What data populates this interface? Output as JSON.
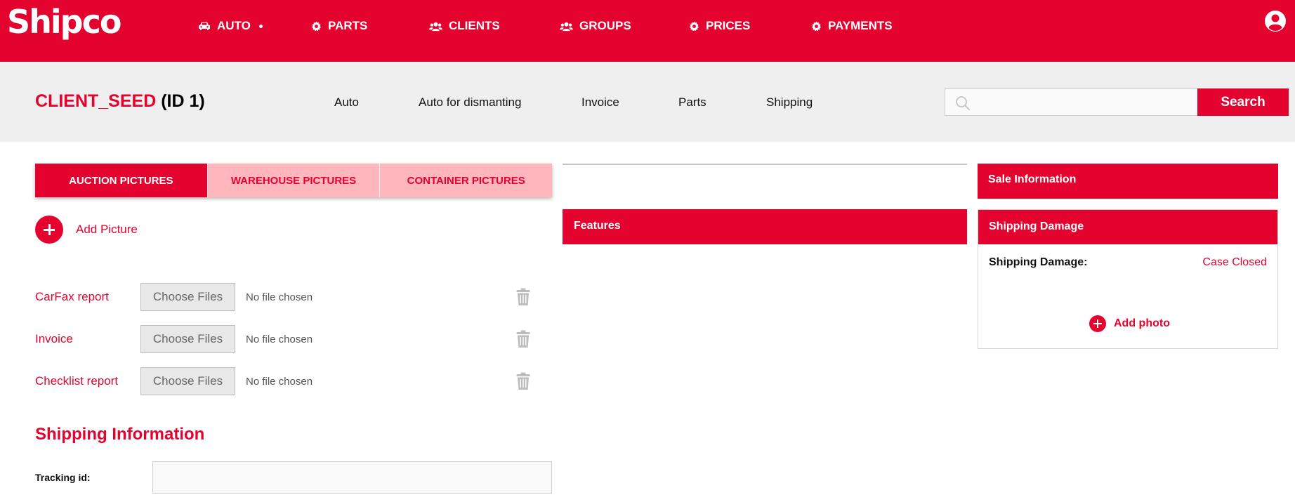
{
  "brand": {
    "name": "Shipco",
    "color": "#e4032e"
  },
  "nav": {
    "items": [
      {
        "label": "AUTO",
        "icon": "car-icon",
        "has_dot": true
      },
      {
        "label": "PARTS",
        "icon": "gear-icon"
      },
      {
        "label": "CLIENTS",
        "icon": "users-icon"
      },
      {
        "label": "GROUPS",
        "icon": "users-icon"
      },
      {
        "label": "PRICES",
        "icon": "gear-icon"
      },
      {
        "label": "PAYMENTS",
        "icon": "gear-icon"
      }
    ],
    "user_icon": "user-circle-icon"
  },
  "client": {
    "name": "CLIENT_SEED",
    "id_text": "(ID 1)"
  },
  "sub_tabs": [
    "Auto",
    "Auto for dismanting",
    "Invoice",
    "Parts",
    "Shipping"
  ],
  "search": {
    "placeholder": "",
    "value": "",
    "button_label": "Search"
  },
  "picture_tabs": [
    {
      "label": "AUCTION PICTURES",
      "active": true
    },
    {
      "label": "WAREHOUSE PICTURES",
      "active": false
    },
    {
      "label": "CONTAINER PICTURES",
      "active": false
    }
  ],
  "add_picture_label": "Add Picture",
  "files": [
    {
      "label": "CarFax report",
      "button": "Choose Files",
      "status": "No file chosen"
    },
    {
      "label": "Invoice",
      "button": "Choose Files",
      "status": "No file chosen"
    },
    {
      "label": "Checklist report",
      "button": "Choose Files",
      "status": "No file chosen"
    }
  ],
  "shipping_info": {
    "heading": "Shipping Information",
    "tracking_label": "Tracking id:",
    "tracking_value": ""
  },
  "features": {
    "title": "Features"
  },
  "sale_info": {
    "title": "Sale Information"
  },
  "shipping_damage": {
    "title": "Shipping Damage",
    "label": "Shipping Damage:",
    "status": "Case Closed",
    "add_photo_label": "Add photo"
  }
}
